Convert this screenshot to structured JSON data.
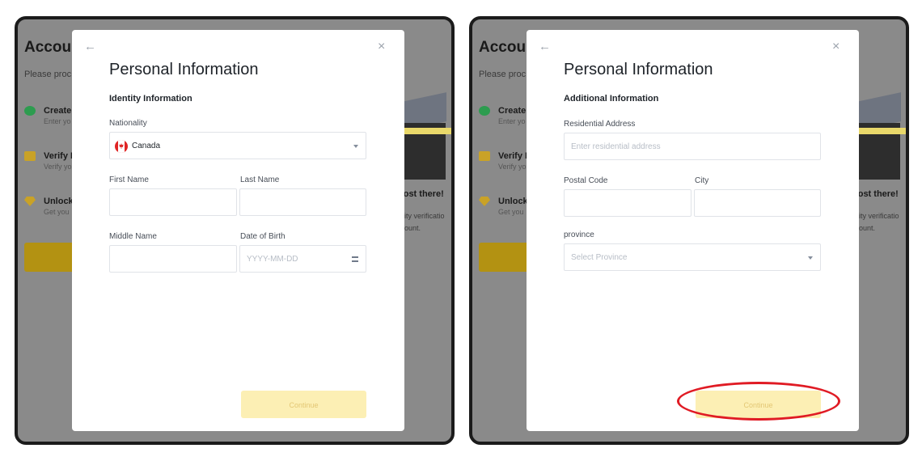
{
  "background": {
    "title": "Accoun",
    "subtitle": "Please proc",
    "steps": [
      {
        "title": "Create",
        "desc": "Enter yo"
      },
      {
        "title": "Verify I",
        "desc": "Verify yo"
      },
      {
        "title": "Unlock",
        "desc": "Get you"
      }
    ],
    "right_title": "nost there!",
    "right_lines": [
      "ity verificatio",
      "ount."
    ]
  },
  "left_modal": {
    "back_icon": "←",
    "close_icon": "×",
    "title": "Personal Information",
    "section": "Identity Information",
    "nationality_label": "Nationality",
    "nationality_value": "Canada",
    "first_name_label": "First Name",
    "first_name_value": "",
    "last_name_label": "Last Name",
    "last_name_value": "",
    "middle_name_label": "Middle Name",
    "middle_name_value": "",
    "dob_label": "Date of Birth",
    "dob_placeholder": "YYYY-MM-DD",
    "continue_label": "Continue"
  },
  "right_modal": {
    "back_icon": "←",
    "close_icon": "×",
    "title": "Personal Information",
    "section": "Additional Information",
    "address_label": "Residential Address",
    "address_placeholder": "Enter residential address",
    "postal_label": "Postal Code",
    "postal_value": "",
    "city_label": "City",
    "city_value": "",
    "province_label": "province",
    "province_placeholder": "Select Province",
    "continue_label": "Continue"
  },
  "colors": {
    "continue_disabled_bg": "#fcefb4",
    "continue_disabled_text": "#e3c774",
    "annotation": "#e01b24"
  }
}
